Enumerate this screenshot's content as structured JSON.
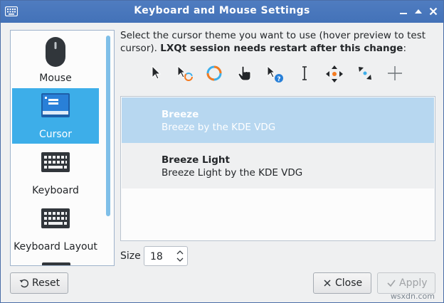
{
  "window": {
    "title": "Keyboard and Mouse Settings"
  },
  "sidebar": {
    "items": [
      {
        "label": "Mouse",
        "icon": "mouse-icon",
        "selected": false
      },
      {
        "label": "Cursor",
        "icon": "cursor-panel-icon",
        "selected": true
      },
      {
        "label": "Keyboard",
        "icon": "keyboard-icon",
        "selected": false
      },
      {
        "label": "Keyboard Layout",
        "icon": "keyboard-layout-icon",
        "selected": false
      }
    ]
  },
  "cursor_page": {
    "intro_text": "Select the cursor theme you want to use (hover preview to test cursor). ",
    "intro_bold": "LXQt session needs restart after this change",
    "intro_suffix": ":",
    "preview_cursors": [
      "arrow-cursor-icon",
      "busy-arrow-cursor-icon",
      "wait-cursor-icon",
      "hand-cursor-icon",
      "help-cursor-icon",
      "ibeam-cursor-icon",
      "move-cursor-icon",
      "resize-diagonal-cursor-icon",
      "crosshair-cursor-icon"
    ],
    "themes": [
      {
        "name": "Breeze",
        "description": "Breeze by the KDE VDG",
        "selected": true
      },
      {
        "name": "Breeze Light",
        "description": "Breeze Light by the KDE VDG",
        "selected": false
      }
    ],
    "size_label": "Size",
    "size_value": "18"
  },
  "buttons": {
    "reset": "Reset",
    "close": "Close",
    "apply": "Apply"
  },
  "watermark": "wsxdn.com",
  "colors": {
    "titlebar": "#4a78bd",
    "selection": "#3daee9",
    "theme_selection": "#b7d7f0"
  }
}
